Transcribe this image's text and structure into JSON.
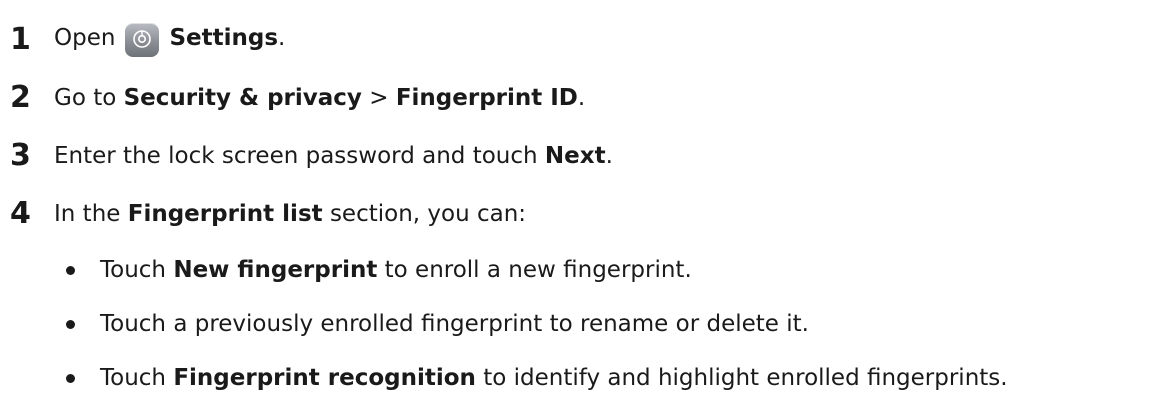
{
  "steps": [
    {
      "number": "1",
      "open_label": "Open",
      "settings_label": "Settings",
      "end_punct": "."
    },
    {
      "number": "2",
      "prefix": "Go to",
      "path_part1": "Security & privacy",
      "separator": ">",
      "path_part2": "Fingerprint ID",
      "end_punct": "."
    },
    {
      "number": "3",
      "prefix": "Enter the lock screen password and touch",
      "action": "Next",
      "end_punct": "."
    },
    {
      "number": "4",
      "prefix": "In the",
      "section": "Fingerprint list",
      "suffix": "section, you can:"
    }
  ],
  "bullets": [
    {
      "prefix": "Touch",
      "action": "New fingerprint",
      "suffix": "to enroll a new fingerprint."
    },
    {
      "text": "Touch a previously enrolled fingerprint to rename or delete it."
    },
    {
      "prefix": "Touch",
      "action": "Fingerprint recognition",
      "suffix": "to identify and highlight enrolled fingerprints."
    }
  ],
  "icons": {
    "settings": "settings-gear-icon"
  }
}
